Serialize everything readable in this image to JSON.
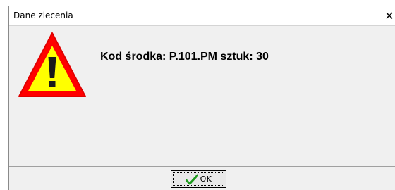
{
  "window": {
    "title": "Dane zlecenia",
    "close_glyph": "✕"
  },
  "message": {
    "text": "Kod środka: P.101.PM sztuk: 30",
    "icon": "warning-icon"
  },
  "buttons": {
    "ok_label": "OK",
    "ok_icon": "checkmark-icon"
  },
  "colors": {
    "dialog_bg": "#f0f0f0",
    "warning_red": "#ff0000",
    "warning_yellow": "#ffff00",
    "check_green": "#1e9a1e"
  }
}
